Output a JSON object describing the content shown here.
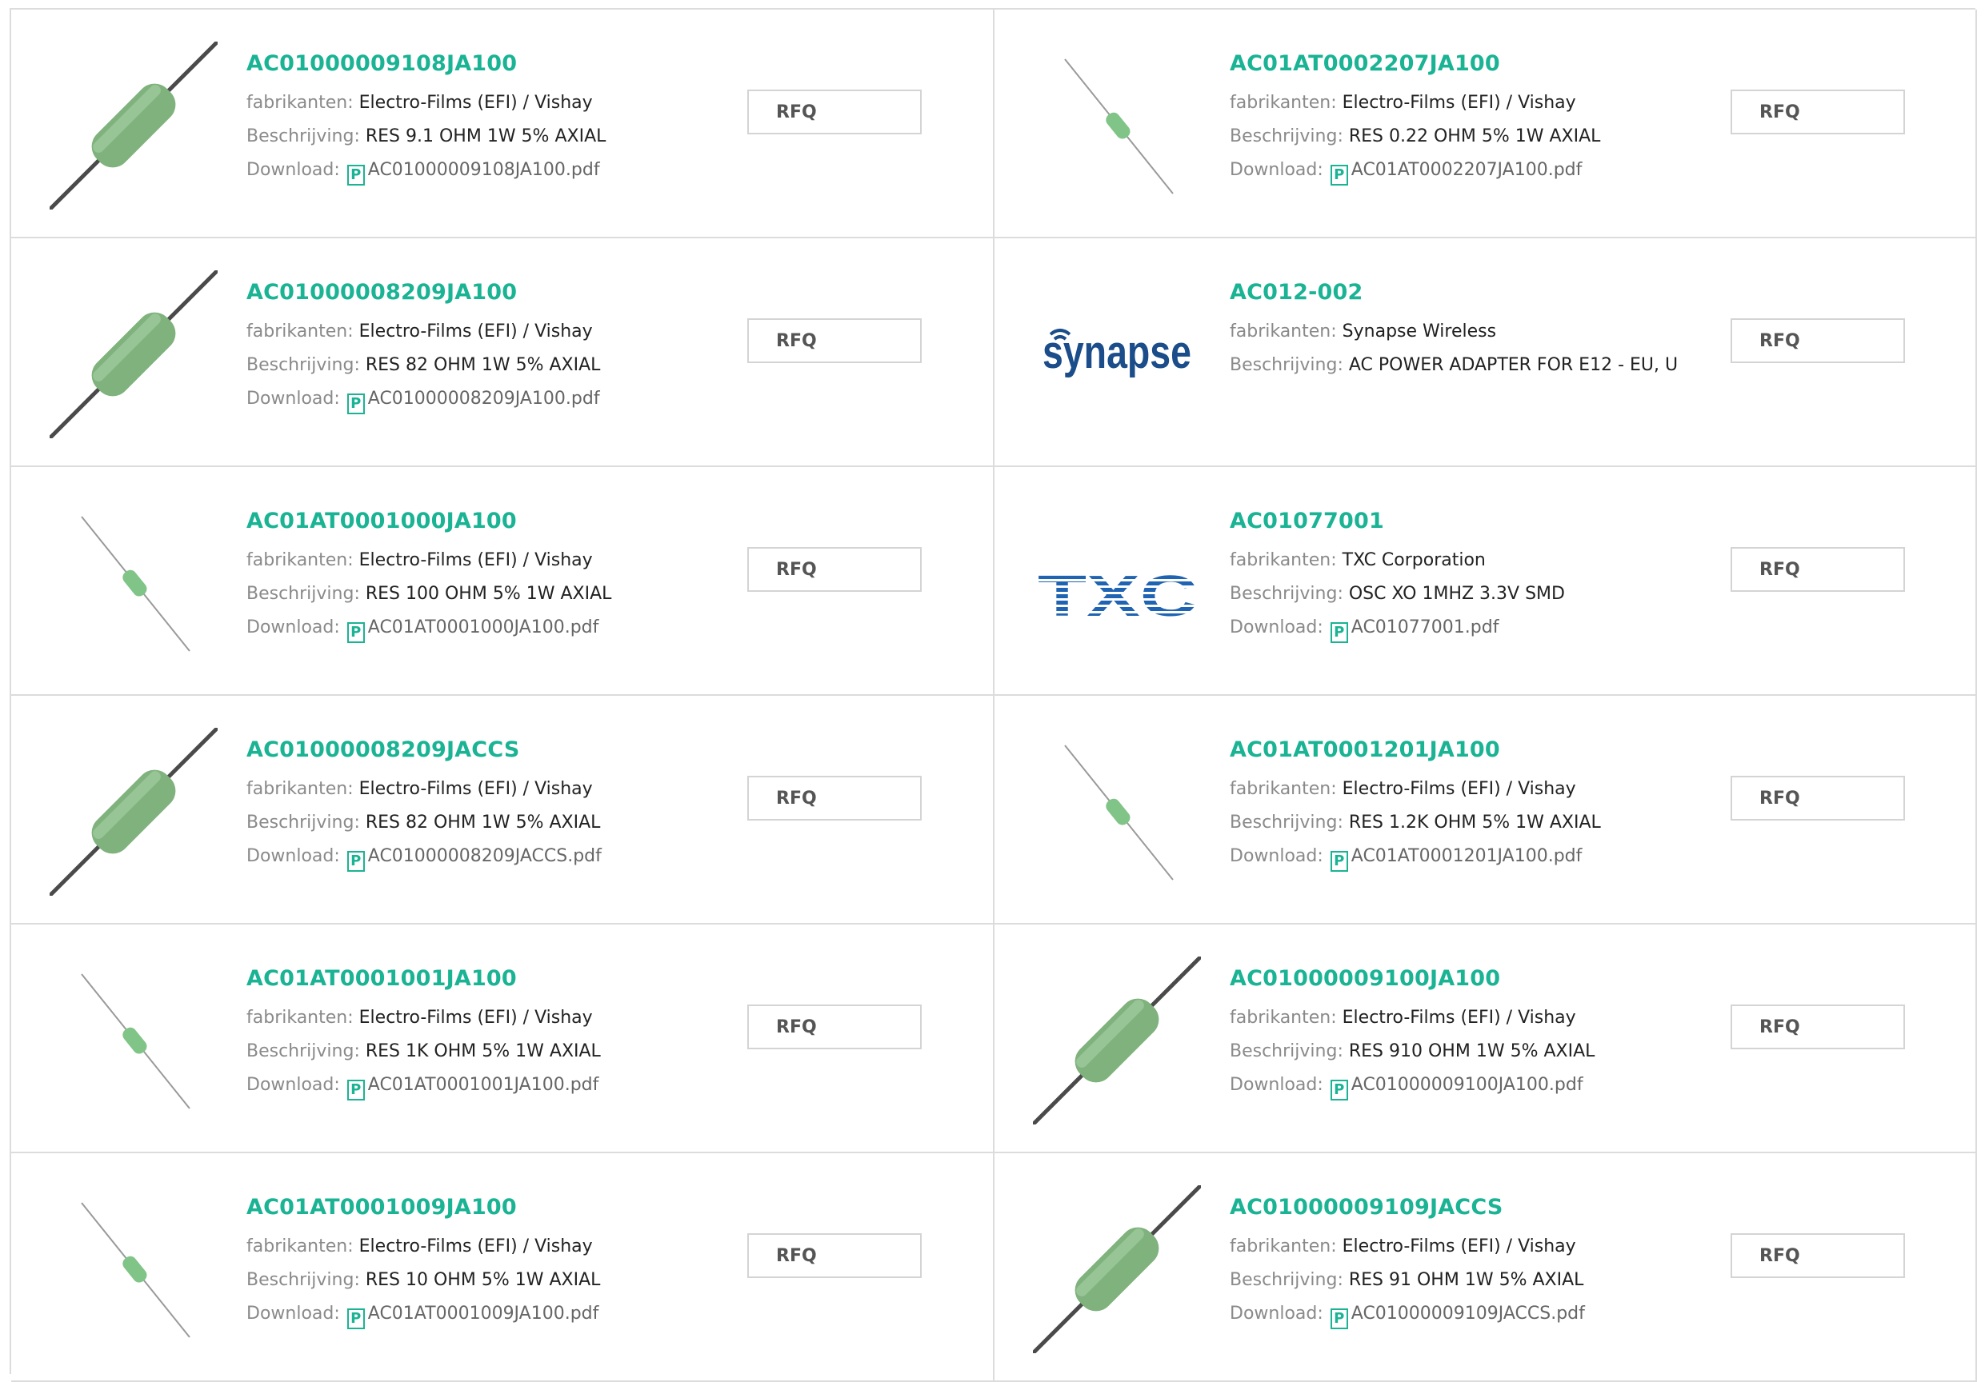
{
  "labels": {
    "manufacturer": "fabrikanten:",
    "description": "Beschrijving:",
    "download": "Download:",
    "rfq": "RFQ",
    "pdf_glyph": "P"
  },
  "colors": {
    "accent": "#1ab394",
    "border": "#dcdcdc"
  },
  "products": [
    {
      "part": "AC01000009108JA100",
      "manufacturer": "Electro-Films (EFI) / Vishay",
      "description": "RES 9.1 OHM 1W 5% AXIAL",
      "file": "AC01000009108JA100.pdf",
      "image": "resistor-large"
    },
    {
      "part": "AC01AT0002207JA100",
      "manufacturer": "Electro-Films (EFI) / Vishay",
      "description": "RES 0.22 OHM 5% 1W AXIAL",
      "file": "AC01AT0002207JA100.pdf",
      "image": "resistor-small"
    },
    {
      "part": "AC01000008209JA100",
      "manufacturer": "Electro-Films (EFI) / Vishay",
      "description": "RES 82 OHM 1W 5% AXIAL",
      "file": "AC01000008209JA100.pdf",
      "image": "resistor-large"
    },
    {
      "part": "AC012-002",
      "manufacturer": "Synapse Wireless",
      "description": "AC POWER ADAPTER FOR E12 - EU, U",
      "file": null,
      "image": "synapse-logo",
      "logo_text": "synapse"
    },
    {
      "part": "AC01AT0001000JA100",
      "manufacturer": "Electro-Films (EFI) / Vishay",
      "description": "RES 100 OHM 5% 1W AXIAL",
      "file": "AC01AT0001000JA100.pdf",
      "image": "resistor-small"
    },
    {
      "part": "AC01077001",
      "manufacturer": "TXC Corporation",
      "description": "OSC XO 1MHZ 3.3V SMD",
      "file": "AC01077001.pdf",
      "image": "txc-logo",
      "logo_text": "TXC"
    },
    {
      "part": "AC01000008209JACCS",
      "manufacturer": "Electro-Films (EFI) / Vishay",
      "description": "RES 82 OHM 1W 5% AXIAL",
      "file": "AC01000008209JACCS.pdf",
      "image": "resistor-large"
    },
    {
      "part": "AC01AT0001201JA100",
      "manufacturer": "Electro-Films (EFI) / Vishay",
      "description": "RES 1.2K OHM 5% 1W AXIAL",
      "file": "AC01AT0001201JA100.pdf",
      "image": "resistor-small"
    },
    {
      "part": "AC01AT0001001JA100",
      "manufacturer": "Electro-Films (EFI) / Vishay",
      "description": "RES 1K OHM 5% 1W AXIAL",
      "file": "AC01AT0001001JA100.pdf",
      "image": "resistor-small"
    },
    {
      "part": "AC01000009100JA100",
      "manufacturer": "Electro-Films (EFI) / Vishay",
      "description": "RES 910 OHM 1W 5% AXIAL",
      "file": "AC01000009100JA100.pdf",
      "image": "resistor-large"
    },
    {
      "part": "AC01AT0001009JA100",
      "manufacturer": "Electro-Films (EFI) / Vishay",
      "description": "RES 10 OHM 5% 1W AXIAL",
      "file": "AC01AT0001009JA100.pdf",
      "image": "resistor-small"
    },
    {
      "part": "AC01000009109JACCS",
      "manufacturer": "Electro-Films (EFI) / Vishay",
      "description": "RES 91 OHM 1W 5% AXIAL",
      "file": "AC01000009109JACCS.pdf",
      "image": "resistor-large"
    }
  ]
}
